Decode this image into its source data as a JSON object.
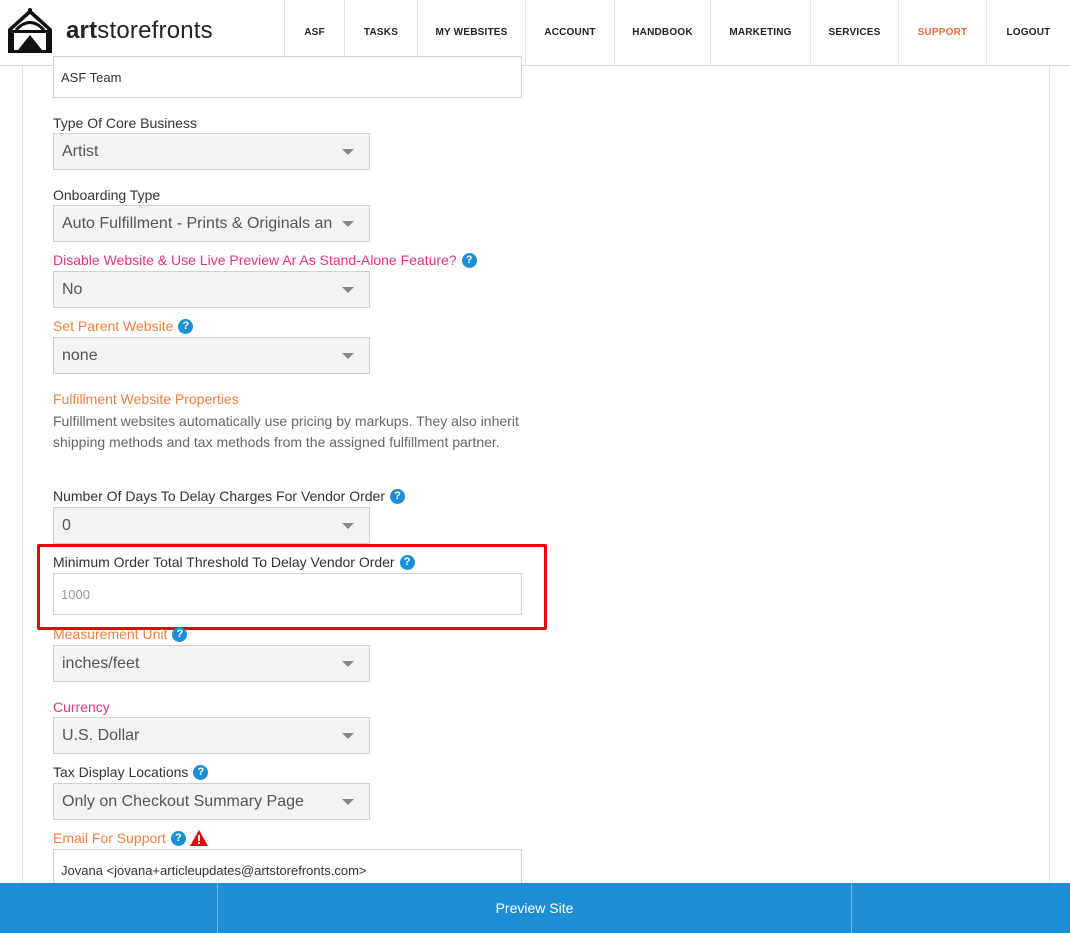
{
  "header": {
    "logo_bold": "art",
    "logo_rest": "storefronts",
    "nav": [
      {
        "label": "ASF",
        "active": false
      },
      {
        "label": "TASKS",
        "active": false
      },
      {
        "label": "MY WEBSITES",
        "active": false
      },
      {
        "label": "ACCOUNT",
        "active": false
      },
      {
        "label": "HANDBOOK",
        "active": false
      },
      {
        "label": "MARKETING",
        "active": false
      },
      {
        "label": "SERVICES",
        "active": false
      },
      {
        "label": "SUPPORT",
        "active": true
      },
      {
        "label": "LOGOUT",
        "active": false
      }
    ]
  },
  "form": {
    "team_field_value": "ASF Team",
    "core_business": {
      "label": "Type Of Core Business",
      "value": "Artist"
    },
    "onboarding": {
      "label": "Onboarding Type",
      "value": "Auto Fulfillment - Prints & Originals and/or Print on Demand"
    },
    "disable_website": {
      "label": "Disable Website & Use Live Preview Ar As Stand-Alone Feature?",
      "value": "No"
    },
    "parent_website": {
      "label": "Set Parent Website",
      "value": "none"
    },
    "fulfillment": {
      "heading": "Fulfillment Website Properties",
      "description": "Fulfillment websites automatically use pricing by markups. They also inherit shipping methods and tax methods from the assigned fulfillment partner."
    },
    "delay_days": {
      "label": "Number Of Days To Delay Charges For Vendor Order",
      "value": "0"
    },
    "min_threshold": {
      "label": "Minimum Order Total Threshold To Delay Vendor Order",
      "placeholder": "1000"
    },
    "measurement": {
      "label": "Measurement Unit",
      "value": "inches/feet"
    },
    "currency": {
      "label": "Currency",
      "value": "U.S. Dollar"
    },
    "tax_display": {
      "label": "Tax Display Locations",
      "value": "Only on Checkout Summary Page"
    },
    "support_email": {
      "label": "Email For Support",
      "value": "Jovana <jovana+articleupdates@artstorefronts.com>"
    }
  },
  "footer": {
    "preview_label": "Preview Site"
  },
  "colors": {
    "accent_blue": "#1e8fd6",
    "pink_label": "#e8337f",
    "orange_label": "#f07e3c",
    "highlight_red": "#e8000b",
    "active_nav": "#f06a35"
  },
  "icons": {
    "help": "question-circle",
    "warning": "warning-triangle"
  }
}
